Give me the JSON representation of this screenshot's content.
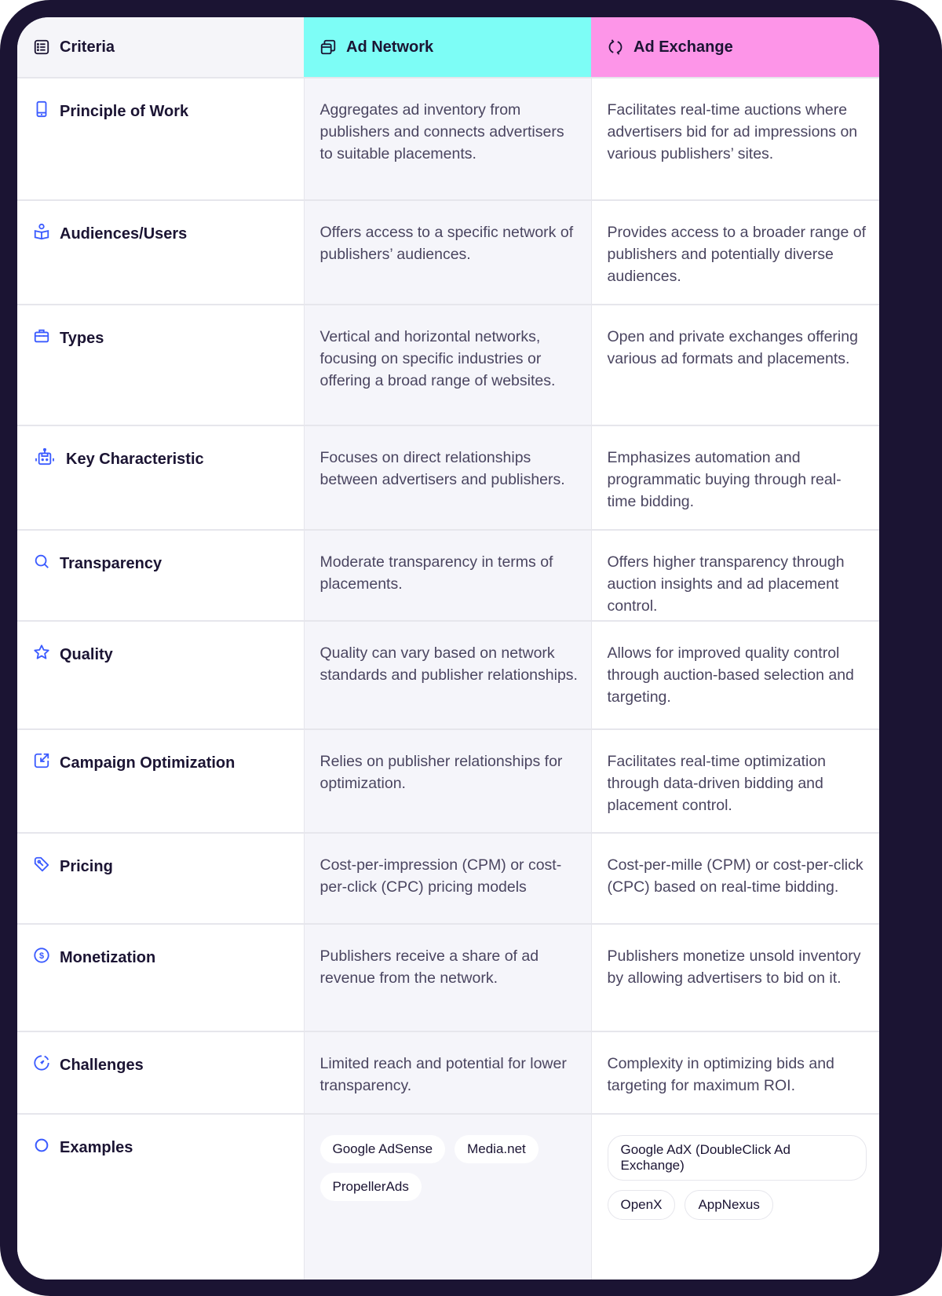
{
  "header": {
    "criteria": "Criteria",
    "ad_network": "Ad Network",
    "ad_exchange": "Ad Exchange",
    "criteria_icon": "list-icon",
    "network_icon": "stacked-cards-icon",
    "exchange_icon": "refresh-icon"
  },
  "colors": {
    "frame": "#1b1433",
    "network_header": "#7dfdf6",
    "exchange_header": "#fd95e8",
    "icon_accent": "#3b5bff"
  },
  "rows": [
    {
      "criteria": "Principle of Work",
      "icon": "tablet-icon",
      "network": "Aggregates ad inventory from publishers and connects advertisers to suitable placements.",
      "exchange": "Facilitates real-time auctions where advertisers bid for ad impressions on various publishers’ sites."
    },
    {
      "criteria": "Audiences/Users",
      "icon": "user-book-icon",
      "network": "Offers access to a specific network of publishers’ audiences.",
      "exchange": "Provides access to a broader range of publishers and potentially diverse audiences."
    },
    {
      "criteria": "Types",
      "icon": "briefcase-icon",
      "network": "Vertical and horizontal networks, focusing on specific industries or offering a broad range of websites.",
      "exchange": "Open and private exchanges offering various ad formats and placements."
    },
    {
      "criteria": "Key Characteristic",
      "icon": "robot-icon",
      "network": "Focuses on direct relationships between advertisers and publishers.",
      "exchange": "Emphasizes automation and programmatic buying through real-time bidding."
    },
    {
      "criteria": "Transparency",
      "icon": "search-icon",
      "network": "Moderate transparency in terms of placements.",
      "exchange": "Offers higher transparency through auction insights and ad placement control."
    },
    {
      "criteria": "Quality",
      "icon": "star-icon",
      "network": "Quality can vary based on network standards and publisher relationships.",
      "exchange": "Allows for improved quality control through auction-based selection and targeting."
    },
    {
      "criteria": "Campaign Optimization",
      "icon": "external-link-icon",
      "network": "Relies on publisher relationships for optimization.",
      "exchange": "Facilitates real-time optimization through data-driven bidding and placement control."
    },
    {
      "criteria": "Pricing",
      "icon": "tag-icon",
      "network": "Cost-per-impression (CPM) or cost-per-click (CPC) pricing models",
      "exchange": "Cost-per-mille (CPM) or cost-per-click (CPC) based on real-time bidding."
    },
    {
      "criteria": "Monetization",
      "icon": "dollar-circle-icon",
      "network": "Publishers receive a share of ad revenue from the network.",
      "exchange": "Publishers monetize unsold inventory by allowing advertisers to bid on it."
    },
    {
      "criteria": "Challenges",
      "icon": "gauge-icon",
      "network": "Limited reach and potential for lower transparency.",
      "exchange": "Complexity in optimizing bids and targeting for maximum ROI."
    }
  ],
  "examples": {
    "criteria": "Examples",
    "icon": "circle-icon",
    "network": [
      "Google AdSense",
      "Media.net",
      "PropellerAds"
    ],
    "exchange": [
      "Google AdX (DoubleClick Ad Exchange)",
      "OpenX",
      "AppNexus"
    ]
  }
}
